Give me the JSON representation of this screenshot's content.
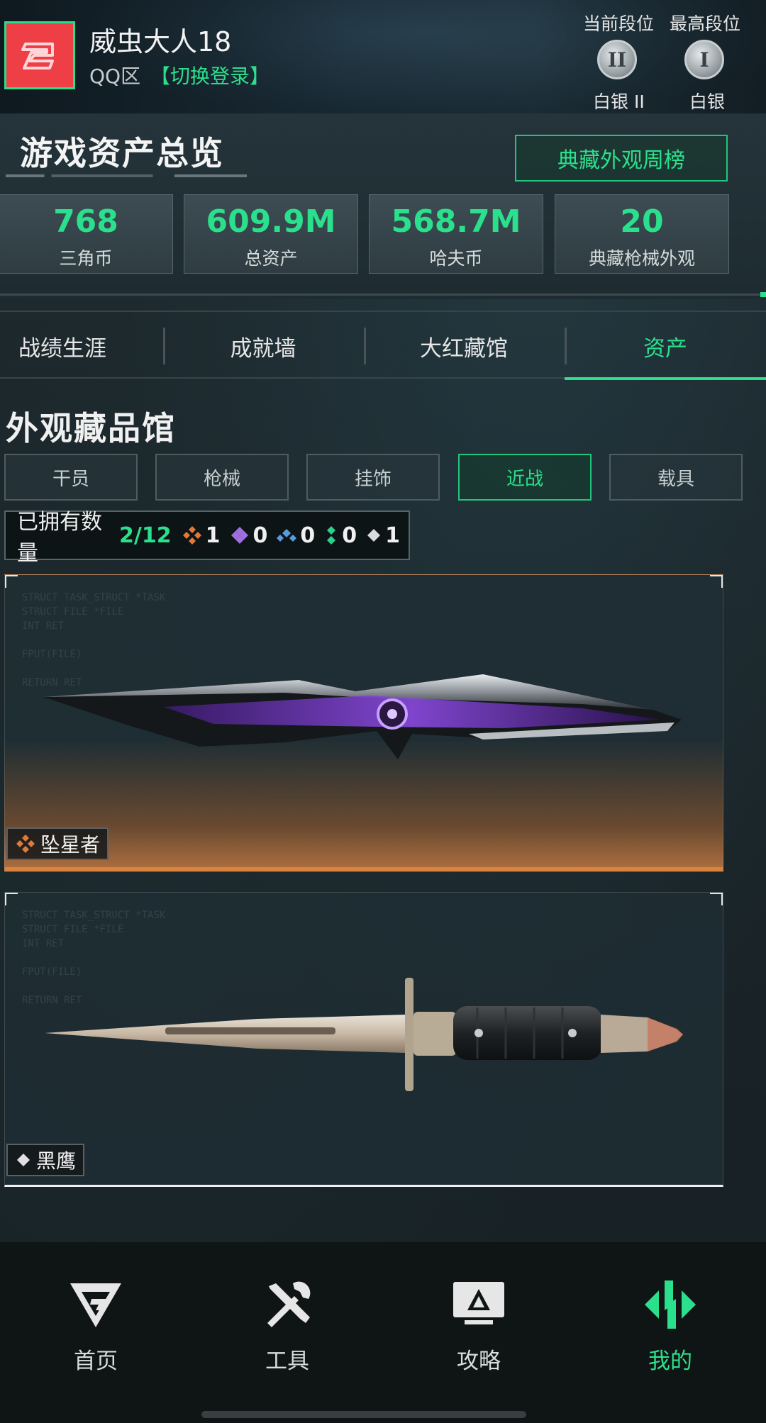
{
  "header": {
    "username": "威虫大人18",
    "zone": "QQ区",
    "switch_login": "【切换登录】",
    "current_rank": {
      "label": "当前段位",
      "badge": "II",
      "name": "白银 II"
    },
    "highest_rank": {
      "label": "最高段位",
      "badge": "I",
      "name": "白银"
    }
  },
  "overview": {
    "title": "游戏资产总览",
    "rank_list_button": "典藏外观周榜",
    "stats": [
      {
        "value": "768",
        "label": "三角币"
      },
      {
        "value": "609.9M",
        "label": "总资产"
      },
      {
        "value": "568.7M",
        "label": "哈夫币"
      },
      {
        "value": "20",
        "label": "典藏枪械外观"
      }
    ]
  },
  "tabs": [
    {
      "label": "战绩生涯"
    },
    {
      "label": "成就墙"
    },
    {
      "label": "大红藏馆"
    },
    {
      "label": "资产",
      "active": true
    }
  ],
  "collection": {
    "title": "外观藏品馆",
    "categories": [
      {
        "label": "干员"
      },
      {
        "label": "枪械"
      },
      {
        "label": "挂饰"
      },
      {
        "label": "近战",
        "active": true
      },
      {
        "label": "载具"
      }
    ],
    "owned_label": "已拥有数量",
    "owned_count": "2/12",
    "tier_counts": [
      {
        "icon": "orange-diamond-icon",
        "color": "#e07a38",
        "count": "1"
      },
      {
        "icon": "purple-diamond-icon",
        "color": "#a070e0",
        "count": "0"
      },
      {
        "icon": "blue-diamond-icon",
        "color": "#5a9ae0",
        "count": "0"
      },
      {
        "icon": "green-diamond-icon",
        "color": "#2bd08c",
        "count": "0"
      },
      {
        "icon": "white-diamond-icon",
        "color": "#d8dcdc",
        "count": "1"
      }
    ],
    "items": [
      {
        "name": "坠星者",
        "tier_color": "#e07a38",
        "icon": "orange-diamond-icon"
      },
      {
        "name": "黑鹰",
        "tier_color": "#e0e0e0",
        "icon": "white-diamond-icon"
      }
    ]
  },
  "bottom_nav": [
    {
      "label": "首页",
      "icon": "home-logo-icon"
    },
    {
      "label": "工具",
      "icon": "tools-icon"
    },
    {
      "label": "攻略",
      "icon": "guide-monitor-icon"
    },
    {
      "label": "我的",
      "icon": "profile-logo-icon",
      "active": true
    }
  ],
  "colors": {
    "accent": "#2be08c",
    "avatar": "#ee3e46",
    "legendary": "#e07a38"
  }
}
